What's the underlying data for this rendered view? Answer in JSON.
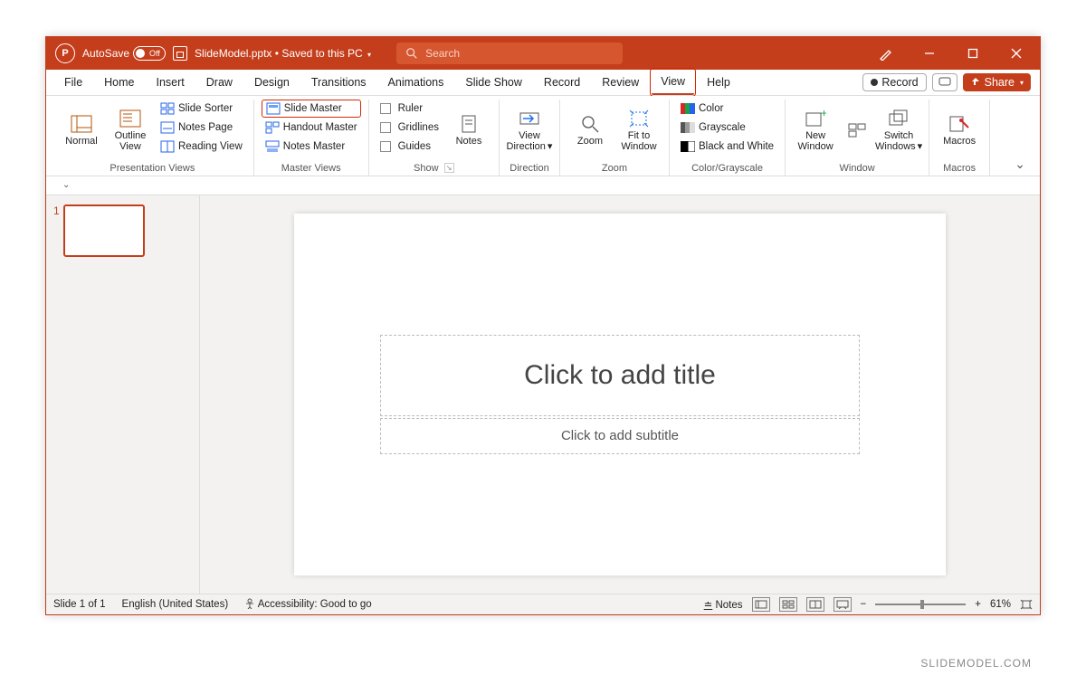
{
  "titlebar": {
    "autosave_label": "AutoSave",
    "autosave_state": "Off",
    "filename": "SlideModel.pptx",
    "save_state": "Saved to this PC",
    "search_placeholder": "Search"
  },
  "tabs": {
    "items": [
      "File",
      "Home",
      "Insert",
      "Draw",
      "Design",
      "Transitions",
      "Animations",
      "Slide Show",
      "Record",
      "Review",
      "View",
      "Help"
    ],
    "active": "View",
    "record_btn": "Record",
    "share_btn": "Share"
  },
  "ribbon": {
    "presentation_views": {
      "group": "Presentation Views",
      "normal": "Normal",
      "outline": "Outline View",
      "slide_sorter": "Slide Sorter",
      "notes_page": "Notes Page",
      "reading_view": "Reading View"
    },
    "master_views": {
      "group": "Master Views",
      "slide_master": "Slide Master",
      "handout_master": "Handout Master",
      "notes_master": "Notes Master"
    },
    "show": {
      "group": "Show",
      "ruler": "Ruler",
      "gridlines": "Gridlines",
      "guides": "Guides"
    },
    "notes_btn": "Notes",
    "direction": {
      "group": "Direction",
      "btn": "View Direction"
    },
    "zoom": {
      "group": "Zoom",
      "zoom": "Zoom",
      "fit": "Fit to Window"
    },
    "colorgray": {
      "group": "Color/Grayscale",
      "color": "Color",
      "grayscale": "Grayscale",
      "bw": "Black and White"
    },
    "window": {
      "group": "Window",
      "new_window": "New Window",
      "switch": "Switch Windows"
    },
    "macros": {
      "group": "Macros",
      "btn": "Macros"
    }
  },
  "thumbnails": {
    "slide1_num": "1"
  },
  "slide": {
    "title_ph": "Click to add title",
    "subtitle_ph": "Click to add subtitle"
  },
  "status": {
    "slide_info": "Slide 1 of 1",
    "language": "English (United States)",
    "accessibility": "Accessibility: Good to go",
    "notes": "Notes",
    "zoom_pct": "61%"
  },
  "branding": "SLIDEMODEL.COM"
}
